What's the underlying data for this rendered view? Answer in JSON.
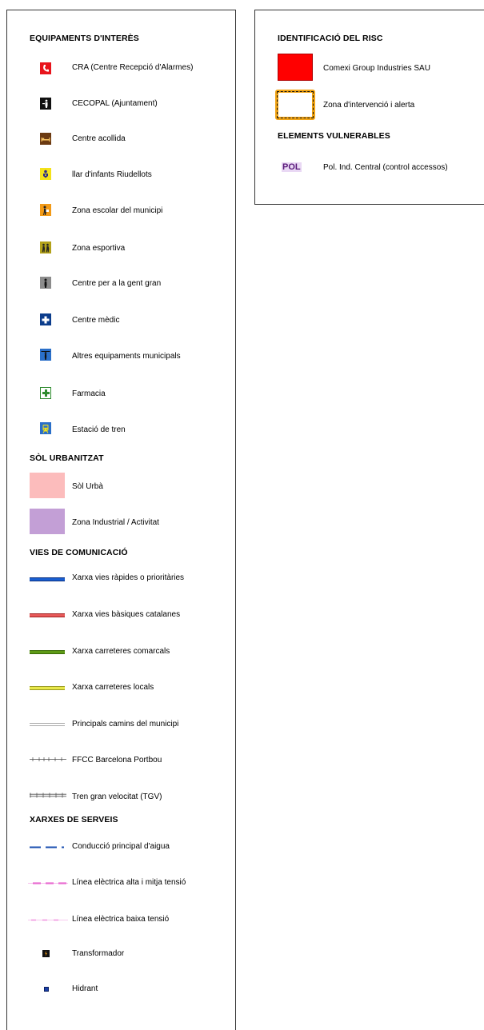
{
  "left": {
    "equipaments": {
      "heading": "EQUIPAMENTS D'INTERÈS",
      "items": [
        {
          "label": "CRA (Centre Recepció d'Alarmes)",
          "icon": "phone-icon",
          "color": "#e8141c"
        },
        {
          "label": "CECOPAL (Ajuntament)",
          "icon": "person-podium-icon",
          "color": "#111111"
        },
        {
          "label": "Centre acollida",
          "icon": "bed-icon",
          "color": "#6b3a12"
        },
        {
          "label": "llar d'infants Riudellots",
          "icon": "baby-icon",
          "color": "#f4e21a"
        },
        {
          "label": "Zona escolar del municipi",
          "icon": "student-icon",
          "color": "#f29a17"
        },
        {
          "label": "Zona esportiva",
          "icon": "athletes-icon",
          "color": "#b3a21a"
        },
        {
          "label": "Centre per a la gent gran",
          "icon": "elderly-person-icon",
          "color": "#8c8c8c"
        },
        {
          "label": "Centre mèdic",
          "icon": "medical-cross-icon",
          "color": "#0c3d8c"
        },
        {
          "label": "Altres equipaments municipals",
          "icon": "municipal-person-icon",
          "color": "#2a6fc9"
        },
        {
          "label": "Farmacia",
          "icon": "pharmacy-cross-icon",
          "color": "#2e8b2e"
        },
        {
          "label": "Estació de tren",
          "icon": "train-icon",
          "color": "#2a6fc9"
        }
      ]
    },
    "sol": {
      "heading": "SÒL URBANITZAT",
      "items": [
        {
          "label": "Sòl Urbà",
          "color": "#fcbcbc"
        },
        {
          "label": "Zona Industrial / Activitat",
          "color": "#c39fd6"
        }
      ]
    },
    "vies": {
      "heading": "VIES DE COMUNICACIÓ",
      "items": [
        {
          "label": "Xarxa vies ràpides o prioritàries",
          "color": "#1a5fd1"
        },
        {
          "label": "Xarxa vies bàsiques catalanes",
          "color": "#e85a5a"
        },
        {
          "label": "Xarxa carreteres comarcals",
          "color": "#5e9a16"
        },
        {
          "label": "Xarxa carreteres locals",
          "color": "#e8e84a"
        },
        {
          "label": "Principals camins del municipi",
          "color": "#c8c8c8"
        },
        {
          "label": "FFCC Barcelona Portbou",
          "color": "#444444"
        },
        {
          "label": "Tren gran velocitat (TGV)",
          "color": "#555555"
        }
      ]
    },
    "xarxes": {
      "heading": "XARXES DE SERVEIS",
      "items": [
        {
          "label": "Conducció principal d'aigua",
          "color": "#1a4fb0"
        },
        {
          "label": "Línea elèctrica alta i mitja tensió",
          "color": "#e86ad0"
        },
        {
          "label": "Línea elèctrica baixa tensió",
          "color": "#ee88dc"
        },
        {
          "label": "Transformador",
          "icon": "transformer-icon",
          "color": "#111111"
        },
        {
          "label": "Hidrant",
          "icon": "hydrant-icon",
          "color": "#1a3fa8"
        }
      ]
    }
  },
  "right": {
    "risc": {
      "heading": "IDENTIFICACIÓ DEL RISC",
      "items": [
        {
          "label": "Comexi Group Industries SAU",
          "color": "#ff0000"
        },
        {
          "label": "Zona d'intervenció i alerta",
          "color": "#f2a516"
        }
      ]
    },
    "vulnerables": {
      "heading": "ELEMENTS VULNERABLES",
      "items": [
        {
          "label": "Pol. Ind. Central (control accessos)",
          "badge": "POL",
          "color": "#5a1a7a"
        }
      ]
    }
  }
}
